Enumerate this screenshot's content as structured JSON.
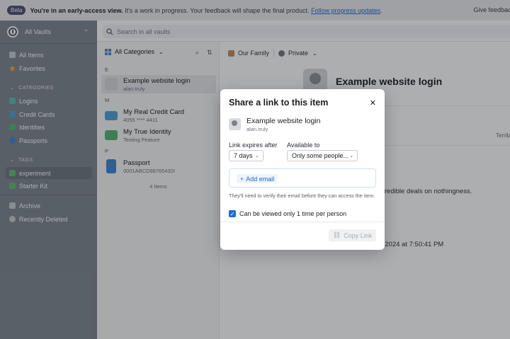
{
  "banner": {
    "badge": "Beta",
    "headline": "You're in an early-access view.",
    "body": " It's a work in progress. Your feedback will shape the final product. ",
    "link": "Follow progress updates",
    "end": ".",
    "right": "Give feedback"
  },
  "sidebar": {
    "vault_name": "All Vaults",
    "top_items": [
      {
        "label": "All Items",
        "icon": "all-items-icon",
        "color": "#c8ccd0"
      },
      {
        "label": "Favorites",
        "icon": "star-icon",
        "color": "#f2b233"
      }
    ],
    "categories_header": "CATEGORIES",
    "categories": [
      {
        "label": "Logins",
        "icon": "login-icon",
        "color": "#5bbcb7"
      },
      {
        "label": "Credit Cards",
        "icon": "credit-card-icon",
        "color": "#4fa0d8"
      },
      {
        "label": "Identities",
        "icon": "identity-icon",
        "color": "#55b56d"
      },
      {
        "label": "Passports",
        "icon": "passport-icon",
        "color": "#3c84d1"
      }
    ],
    "tags_header": "TAGS",
    "tags": [
      {
        "label": "experiment",
        "icon": "tag-icon",
        "color": "#5fbe76"
      },
      {
        "label": "Starter Kit",
        "icon": "tag-icon",
        "color": "#5fbe76"
      }
    ],
    "bottom_items": [
      {
        "label": "Archive",
        "icon": "archive-icon",
        "color": "#c8ccd0"
      },
      {
        "label": "Recently Deleted",
        "icon": "trash-icon",
        "color": "#c8ccd0"
      }
    ]
  },
  "search": {
    "placeholder": "Search in all vaults"
  },
  "list": {
    "filter_label": "All Categories",
    "sections": [
      {
        "letter": "E",
        "items": [
          {
            "title": "Example website login",
            "subtitle": "alan.truly",
            "icon": "key-icon",
            "color": "#d8dadc"
          }
        ]
      },
      {
        "letter": "M",
        "items": [
          {
            "title": "My Real Credit Card",
            "subtitle": "4055 **** 4411",
            "icon": "credit-card-icon",
            "color": "#4fa0d8"
          },
          {
            "title": "My True Identity",
            "subtitle": "Testing Feature",
            "icon": "identity-icon",
            "color": "#55b56d"
          }
        ]
      },
      {
        "letter": "P",
        "items": [
          {
            "title": "Passport",
            "subtitle": "0001ABCD98765432I",
            "icon": "passport-icon",
            "color": "#3c84d1"
          }
        ]
      }
    ],
    "count": "4 Items"
  },
  "detail": {
    "vault": "Our Family",
    "visibility": "Private",
    "title": "Example website login",
    "snippet_right": "Terrib",
    "notes_fragment": "credible deals on nothingness.",
    "date_fragment": ", 2024 at 7:50:41 PM"
  },
  "modal": {
    "title": "Share a link to this item",
    "item_name": "Example website login",
    "item_user": "alan.truly",
    "expires_label": "Link expires after",
    "expires_value": "7 days",
    "available_label": "Available to",
    "available_value": "Only some people...",
    "add_email": "Add email",
    "note": "They'll need to verify their email before they can access the item.",
    "checkbox_label": "Can be viewed only 1 time per person",
    "copy_label": "Copy Link"
  }
}
